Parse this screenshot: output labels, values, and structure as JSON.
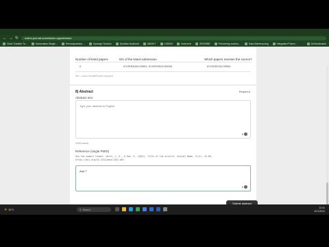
{
  "browser": {
    "url": "online-journal-submission.app/abstract",
    "bookmarks": [
      "Voice Transfer To...",
      "Mammalian Single...",
      "Termodynamics ...",
      "Synergic Toolbox",
      "Symbion Andbook",
      "ABDKIT",
      "LD5000",
      "Inotorrent",
      "JEDSEBE",
      "Premiering custom...",
      "Data Warehousing",
      "Integrated Pharm..."
    ],
    "all_bookmarks": "All Bookmarks"
  },
  "table": {
    "headers": [
      "Number of listed papers",
      "IDs of the listed submission",
      "Which papers mention the source?"
    ],
    "row": [
      "2",
      "ICVISS2024-00001; ICVISS2024-00004",
      "ICVISS2024-00004"
    ],
    "note": "Ref.: Listed Sesult/Review required"
  },
  "abstract": {
    "section_title": "8) Abstract",
    "required": "Required",
    "field_label": "Abstract text",
    "placeholder": "Type your abstract in English",
    "char_count": "0",
    "counter": "0/300 words"
  },
  "reference": {
    "label": "Reference (single PMID)",
    "sample_line1": "Use the sample format: Smith, J. K., & Doe, R. (2021). Title of the article. Journal Name, 12(3), 45-60.",
    "sample_line2": "https://doi.org/10.1234/abcd.2021.001",
    "value": "Add T",
    "char_count": "0"
  },
  "submit_label": "Submit abstract",
  "taskbar": {
    "weather": "26°C",
    "search_placeholder": "Search",
    "time": "12:41",
    "date": "20/1/2024"
  }
}
